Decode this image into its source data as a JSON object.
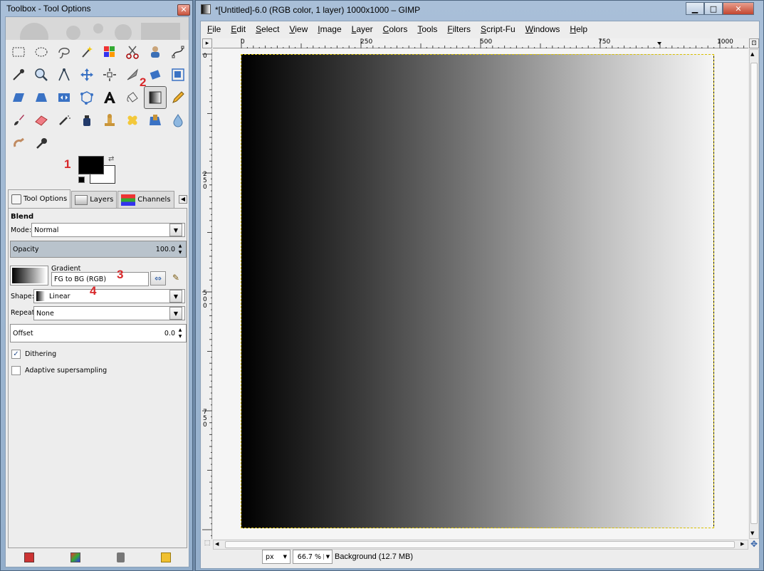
{
  "toolbox": {
    "title": "Toolbox - Tool Options",
    "close_label": "✕",
    "active_tool": "blend-tool",
    "annotations": {
      "n1": "1",
      "n2": "2",
      "n3": "3",
      "n4": "4"
    }
  },
  "tabs": [
    {
      "label": "Tool Options"
    },
    {
      "label": "Layers"
    },
    {
      "label": "Channels"
    }
  ],
  "tool_options": {
    "heading": "Blend",
    "mode_label": "Mode:",
    "mode_value": "Normal",
    "opacity_label": "Opacity",
    "opacity_value": "100.0",
    "gradient_label": "Gradient",
    "gradient_value": "FG to BG (RGB)",
    "shape_label": "Shape:",
    "shape_value": "Linear",
    "repeat_label": "Repeat:",
    "repeat_value": "None",
    "offset_label": "Offset",
    "offset_value": "0.0",
    "dithering_label": "Dithering",
    "dithering_checked": true,
    "adaptive_label": "Adaptive supersampling",
    "adaptive_checked": false
  },
  "colors": {
    "foreground": "#000000",
    "background": "#ffffff"
  },
  "image_window": {
    "title": "*[Untitled]-6.0 (RGB color, 1 layer) 1000x1000 – GIMP",
    "menu": [
      "File",
      "Edit",
      "Select",
      "View",
      "Image",
      "Layer",
      "Colors",
      "Tools",
      "Filters",
      "Script-Fu",
      "Windows",
      "Help"
    ],
    "ruler_h": [
      "0",
      "250",
      "500",
      "750",
      "1000"
    ],
    "ruler_v": [
      "0",
      "250",
      "500",
      "750"
    ],
    "unit": "px",
    "zoom": "66.7 %",
    "status": "Background (12.7 MB)"
  }
}
